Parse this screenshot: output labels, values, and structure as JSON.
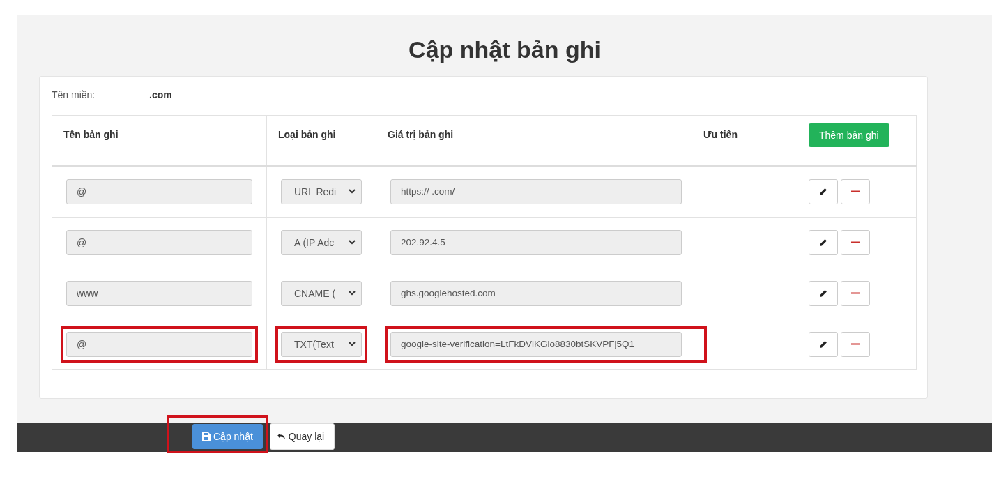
{
  "title": "Cập nhật bản ghi",
  "domain": {
    "label": "Tên miền:",
    "value": ".com"
  },
  "table": {
    "columns": [
      "Tên bản ghi",
      "Loại bản ghi",
      "Giá trị bản ghi",
      "Ưu tiên"
    ],
    "add_button": "Thêm bản ghi",
    "rows": [
      {
        "name": "@",
        "type": "URL Redi",
        "value": "https://          .com/",
        "highlighted": false
      },
      {
        "name": "@",
        "type": "A (IP Adc",
        "value": "202.92.4.5",
        "highlighted": false
      },
      {
        "name": "www",
        "type": "CNAME (",
        "value": "ghs.googlehosted.com",
        "highlighted": false
      },
      {
        "name": "@",
        "type": "TXT(Text",
        "value": "google-site-verification=LtFkDVlKGio8830btSKVPFj5Q1",
        "highlighted": true
      }
    ]
  },
  "buttons": [
    {
      "kind": "save",
      "label": "Cập nhật",
      "highlighted": true
    },
    {
      "kind": "back",
      "label": "Quay lại",
      "highlighted": false
    }
  ]
}
